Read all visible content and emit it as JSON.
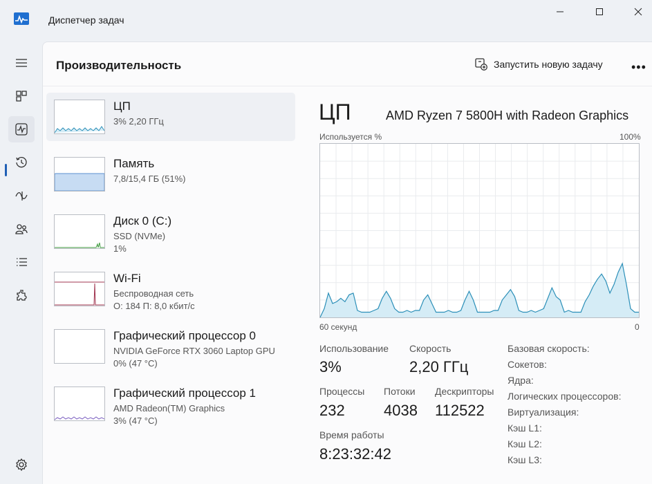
{
  "window": {
    "title": "Диспетчер задач"
  },
  "header": {
    "page_title": "Производительность",
    "new_task_label": "Запустить новую задачу",
    "more_label": "•••"
  },
  "devices": [
    {
      "name": "ЦП",
      "line1": "3% 2,20 ГГц",
      "line2": ""
    },
    {
      "name": "Память",
      "line1": "7,8/15,4 ГБ (51%)",
      "line2": ""
    },
    {
      "name": "Диск 0 (C:)",
      "line1": "SSD (NVMe)",
      "line2": "1%"
    },
    {
      "name": "Wi-Fi",
      "line1": "Беспроводная сеть",
      "line2": "О: 184 П: 8,0 кбит/с"
    },
    {
      "name": "Графический процессор 0",
      "line1": "NVIDIA GeForce RTX 3060 Laptop GPU",
      "line2": "0% (47 °C)"
    },
    {
      "name": "Графический процессор 1",
      "line1": "AMD Radeon(TM) Graphics",
      "line2": "3% (47 °C)"
    }
  ],
  "detail": {
    "title": "ЦП",
    "model": "AMD Ryzen 7 5800H with Radeon Graphics",
    "y_label": "Используется %",
    "y_max_label": "100%",
    "x_left_label": "60 секунд",
    "x_right_label": "0"
  },
  "stats": {
    "usage_label": "Использование",
    "usage_value": "3%",
    "speed_label": "Скорость",
    "speed_value": "2,20 ГГц",
    "processes_label": "Процессы",
    "processes_value": "232",
    "threads_label": "Потоки",
    "threads_value": "4038",
    "handles_label": "Дескрипторы",
    "handles_value": "112522",
    "uptime_label": "Время работы",
    "uptime_value": "8:23:32:42"
  },
  "specs": [
    "Базовая скорость:",
    "Сокетов:",
    "Ядра:",
    "Логических процессоров:",
    "Виртуализация:",
    "Кэш L1:",
    "Кэш L2:",
    "Кэш L3:"
  ],
  "colors": {
    "cpu_line": "#2b8fb8",
    "cpu_fill": "#d5ecf6",
    "mem_line": "#5b8fd0",
    "mem_fill": "#c7dcf3",
    "disk_line": "#3e9a3e",
    "wifi_line": "#a0344f",
    "gpu_line": "#7b5fc0",
    "accent": "#1f5fb5"
  },
  "cpu_usage_history": [
    0,
    5,
    14,
    8,
    9,
    11,
    9,
    13,
    14,
    4,
    3,
    3,
    3,
    4,
    5,
    11,
    15,
    11,
    5,
    3,
    3,
    4,
    3,
    4,
    4,
    10,
    13,
    8,
    3,
    3,
    3,
    4,
    3,
    3,
    4,
    10,
    15,
    10,
    3,
    3,
    3,
    3,
    4,
    4,
    10,
    13,
    16,
    12,
    4,
    3,
    3,
    4,
    3,
    4,
    5,
    11,
    17,
    12,
    10,
    3,
    4,
    3,
    3,
    3,
    9,
    13,
    18,
    22,
    25,
    21,
    14,
    19,
    26,
    31,
    19,
    5,
    3,
    3
  ]
}
